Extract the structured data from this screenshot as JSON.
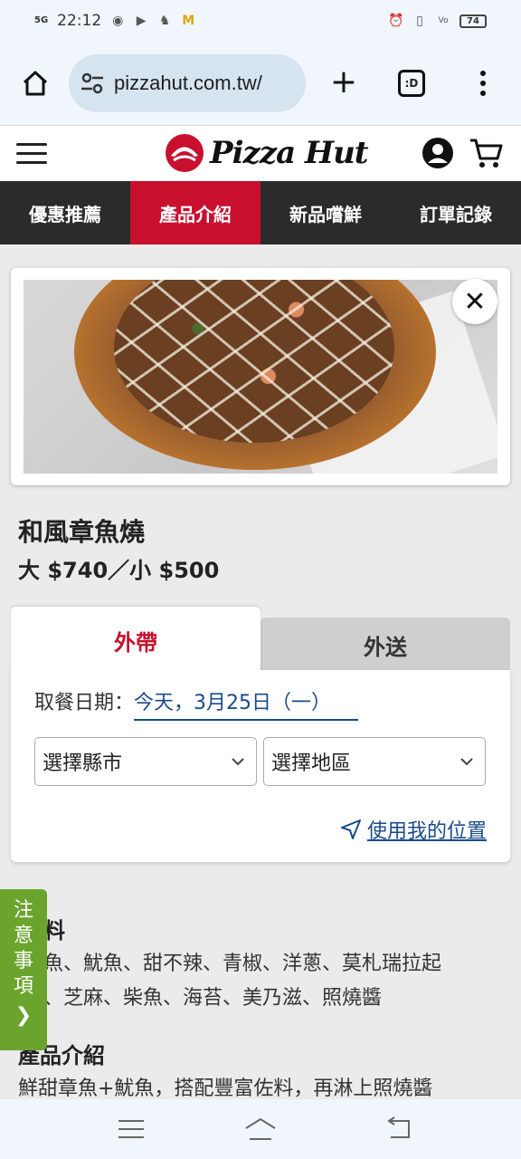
{
  "status_bar": {
    "network": "5G",
    "time": "22:12",
    "battery": "74",
    "volte": "VoLTE"
  },
  "browser": {
    "url": "pizzahut.com.tw/",
    "tabs_label": ":D"
  },
  "site": {
    "brand": "Pizza Hut",
    "nav": [
      "優惠推薦",
      "產品介紹",
      "新品嚐鮮",
      "訂單記錄"
    ],
    "active_nav": 1
  },
  "product": {
    "name": "和風章魚燒",
    "price": "大 $740／小 $500"
  },
  "order": {
    "tabs": [
      "外帶",
      "外送"
    ],
    "active_tab": 0,
    "date_label": "取餐日期：",
    "date_value": "今天，3月25日（一）",
    "city_select": "選擇縣市",
    "area_select": "選擇地區",
    "use_location": "使用我的位置"
  },
  "ingredients": {
    "heading": "料",
    "line1": "魚、魷魚、甜不辣、青椒、洋蔥、莫札瑞拉起",
    "line2": "、芝麻、柴魚、海苔、美乃滋、照燒醬"
  },
  "intro": {
    "heading": "產品介紹",
    "text": "鮮甜章魚+魷魚，搭配豐富佐料，再淋上照燒醬"
  },
  "side_tab": {
    "chars": [
      "注",
      "意",
      "事",
      "項"
    ],
    "arrow": "❯"
  },
  "colors": {
    "brand_red": "#c8102e",
    "nav_dark": "#2b2b2b",
    "link_blue": "#1a4b8a",
    "side_green": "#6aa42d"
  }
}
